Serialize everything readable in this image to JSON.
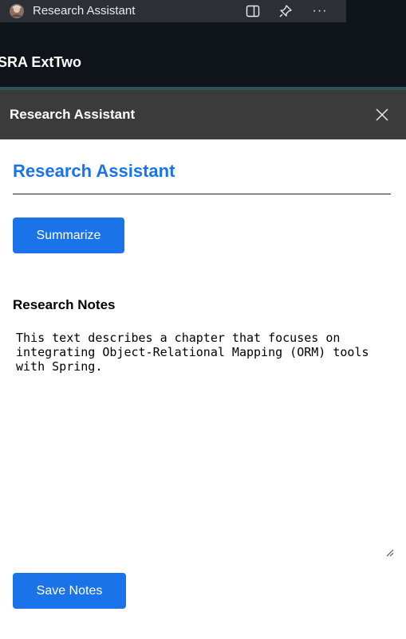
{
  "browser_panel": {
    "title": "Research Assistant",
    "favicon": "extension-avatar-icon",
    "buttons": [
      "split-view-icon",
      "pin-icon",
      "more-options-icon"
    ],
    "more_label": "···"
  },
  "extension": {
    "name": "SRA ExtTwo"
  },
  "dialog": {
    "title": "Research Assistant",
    "close_icon": "close-icon"
  },
  "content": {
    "heading": "Research Assistant",
    "summarize_label": "Summarize",
    "notes_label": "Research Notes",
    "notes_value": "This text describes a chapter that focuses on integrating Object-Relational Mapping (ORM) tools with Spring.",
    "save_label": "Save Notes"
  },
  "colors": {
    "accent": "#1a73e8",
    "browser_chrome": "#0f141b",
    "dialog_header": "#3b3b3b",
    "teal_separator": "#2c5558"
  }
}
